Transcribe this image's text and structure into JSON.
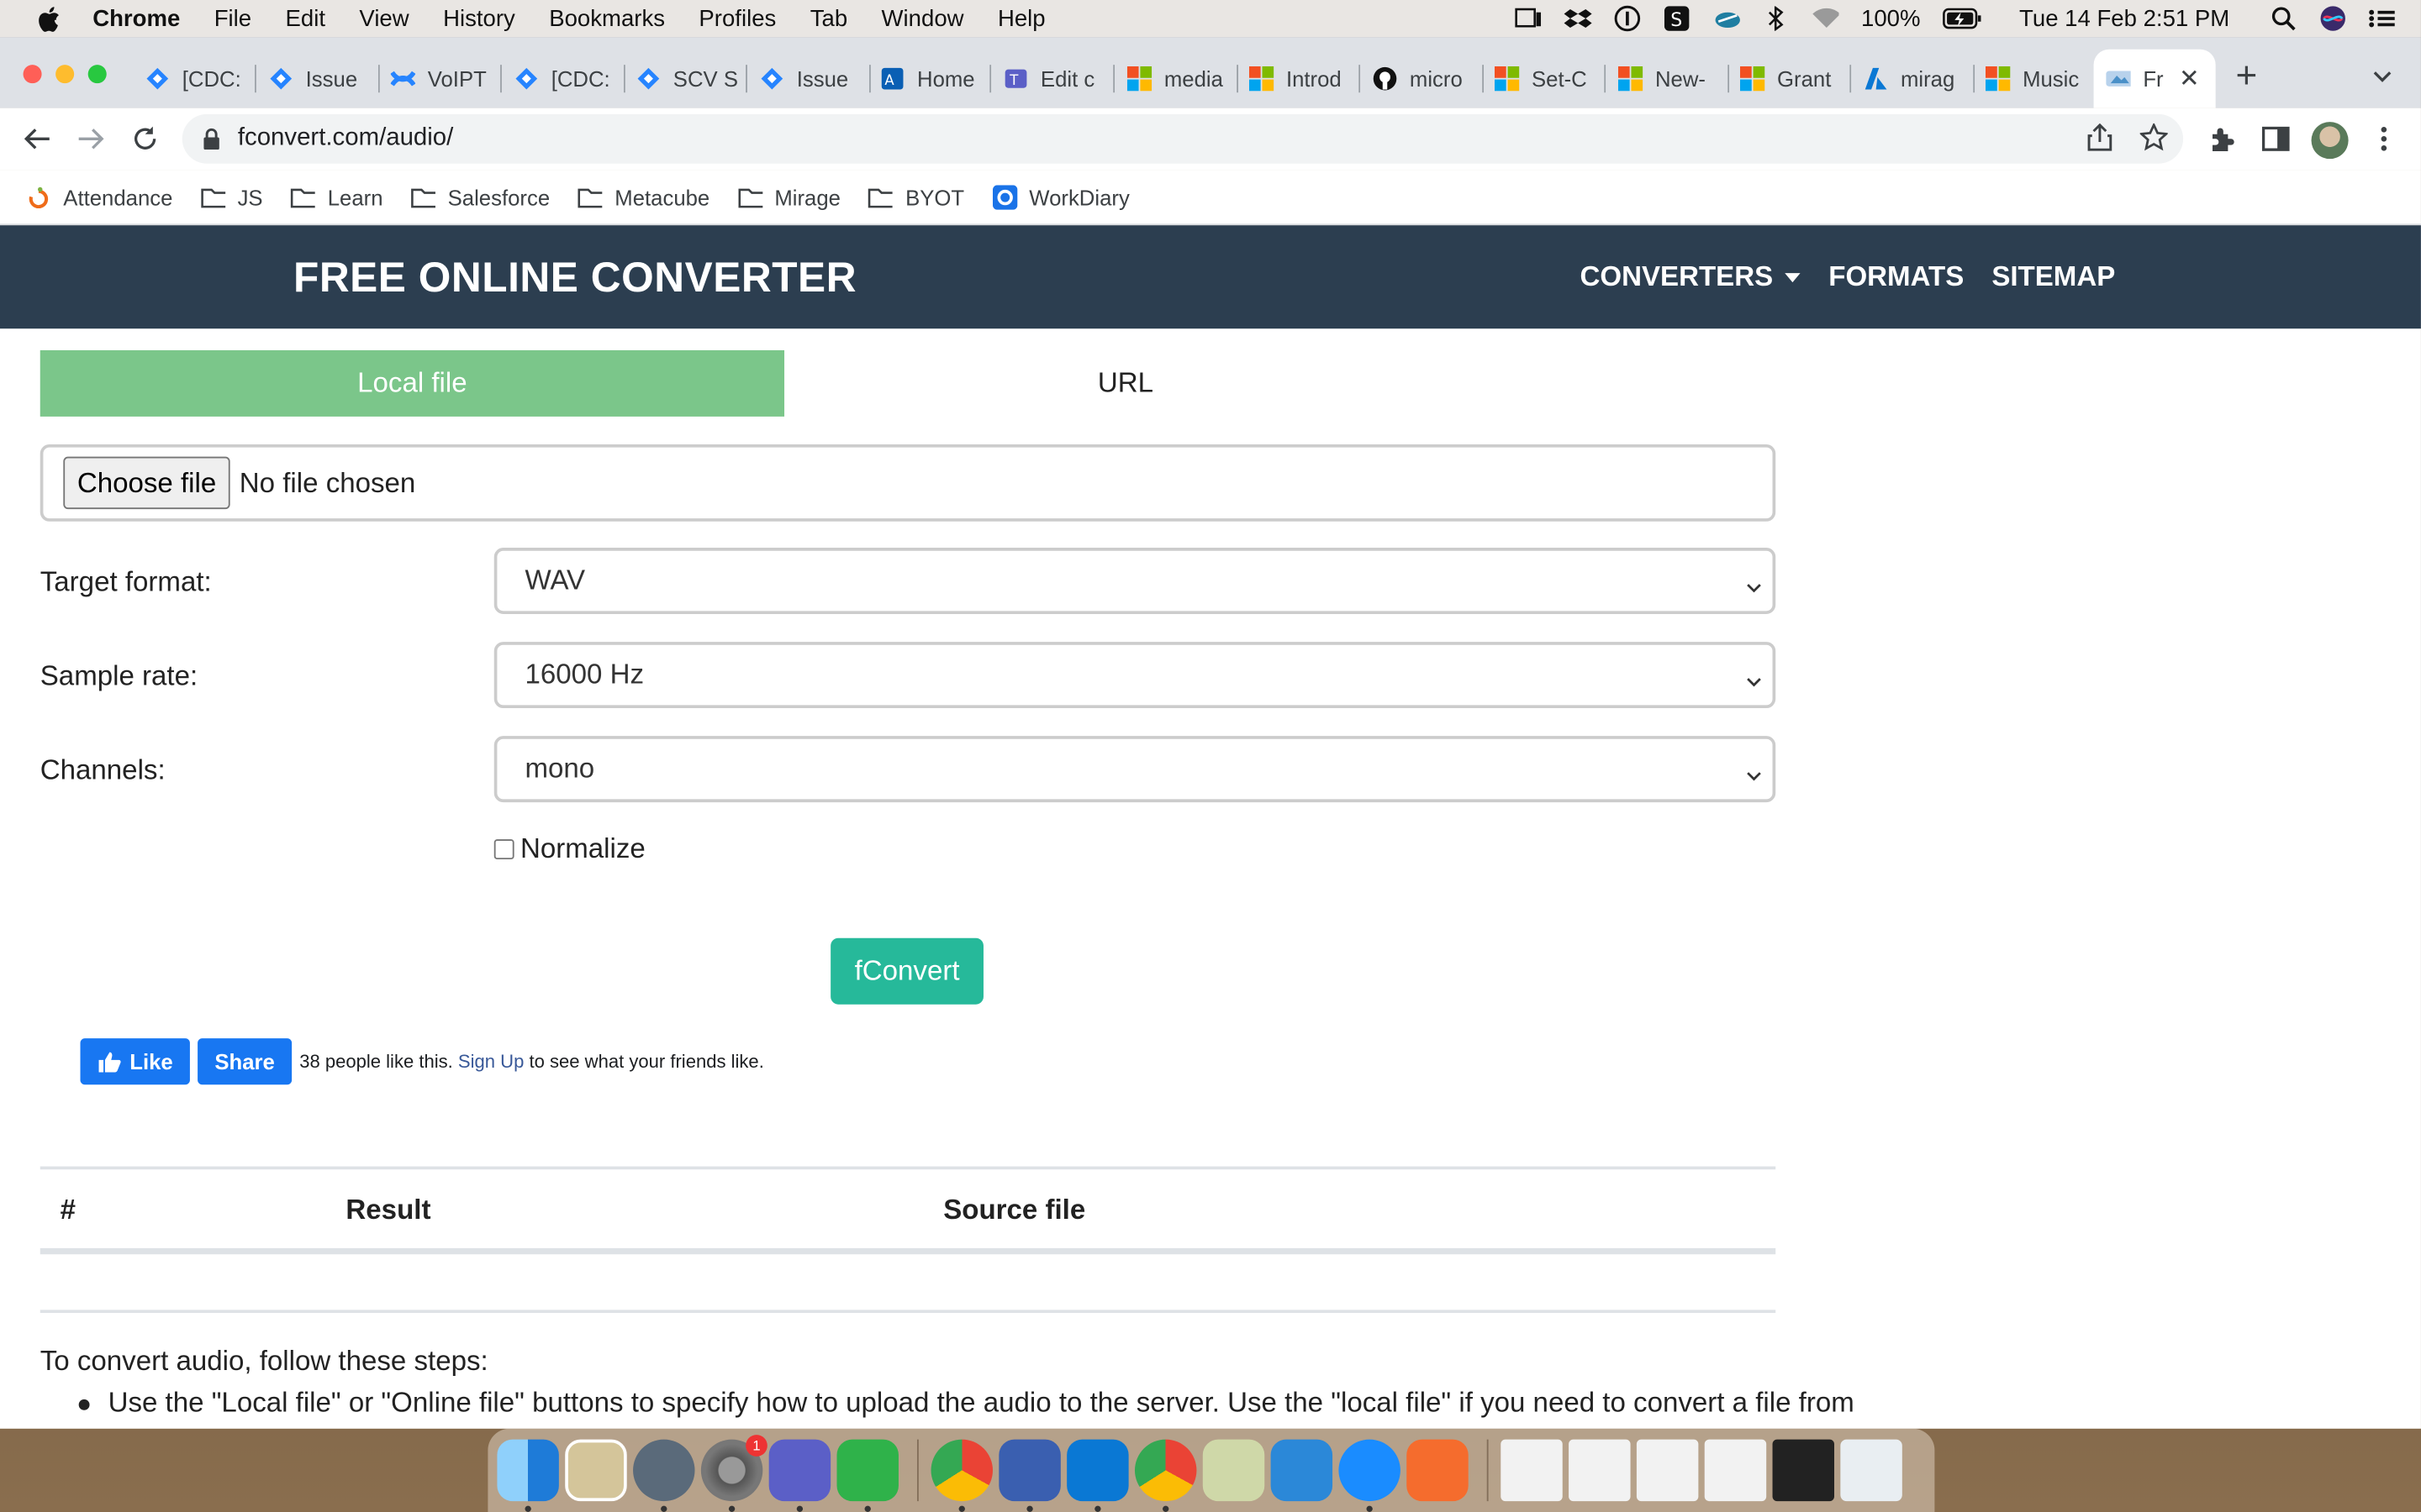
{
  "menubar": {
    "app": "Chrome",
    "items": [
      "File",
      "Edit",
      "View",
      "History",
      "Bookmarks",
      "Profiles",
      "Tab",
      "Window",
      "Help"
    ],
    "battery": "100%",
    "datetime": "Tue 14 Feb  2:51 PM"
  },
  "tabs": [
    {
      "label": "[CDC:",
      "icon": "jira-icon"
    },
    {
      "label": "Issue",
      "icon": "jira-icon"
    },
    {
      "label": "VoIPT",
      "icon": "confluence-icon"
    },
    {
      "label": "[CDC:",
      "icon": "jira-icon"
    },
    {
      "label": "SCV S",
      "icon": "jira-icon"
    },
    {
      "label": "Issue",
      "icon": "jira-icon"
    },
    {
      "label": "Home",
      "icon": "azure-icon"
    },
    {
      "label": "Edit c",
      "icon": "teams-icon"
    },
    {
      "label": "media",
      "icon": "microsoft-icon"
    },
    {
      "label": "Introd",
      "icon": "microsoft-icon"
    },
    {
      "label": "micro",
      "icon": "github-icon"
    },
    {
      "label": "Set-C",
      "icon": "microsoft-icon"
    },
    {
      "label": "New-",
      "icon": "microsoft-icon"
    },
    {
      "label": "Grant",
      "icon": "microsoft-icon"
    },
    {
      "label": "mirag",
      "icon": "azure-icon"
    },
    {
      "label": "Music",
      "icon": "microsoft-icon"
    }
  ],
  "active_tab": {
    "label": "Fr",
    "icon": "fconvert-icon"
  },
  "address_bar": {
    "url": "fconvert.com/audio/"
  },
  "bookmarks": [
    {
      "label": "Attendance",
      "icon": "attendance-icon"
    },
    {
      "label": "JS",
      "icon": "folder-icon"
    },
    {
      "label": "Learn",
      "icon": "folder-icon"
    },
    {
      "label": "Salesforce",
      "icon": "folder-icon"
    },
    {
      "label": "Metacube",
      "icon": "folder-icon"
    },
    {
      "label": "Mirage",
      "icon": "folder-icon"
    },
    {
      "label": "BYOT",
      "icon": "folder-icon"
    },
    {
      "label": "WorkDiary",
      "icon": "workdiary-icon"
    }
  ],
  "site": {
    "title": "FREE ONLINE CONVERTER",
    "nav": {
      "converters": "CONVERTERS",
      "formats": "FORMATS",
      "sitemap": "SITEMAP"
    },
    "header_color": "#2c3e50"
  },
  "upload": {
    "tab_local": "Local file",
    "tab_url": "URL",
    "choose_button": "Choose file",
    "file_status": "No file chosen",
    "active_color": "#7bc68a"
  },
  "form": {
    "target_format_label": "Target format:",
    "target_format_value": "WAV",
    "sample_rate_label": "Sample rate:",
    "sample_rate_value": "16000 Hz",
    "channels_label": "Channels:",
    "channels_value": "mono",
    "normalize_label": "Normalize",
    "normalize_checked": false,
    "submit_label": "fConvert",
    "submit_color": "#26b99a"
  },
  "facebook": {
    "like": "Like",
    "share": "Share",
    "text_before": "38 people like this.",
    "signup": "Sign Up",
    "text_after": "to see what your friends like."
  },
  "results_table": {
    "headers": [
      "#",
      "Result",
      "Source file"
    ]
  },
  "instructions": {
    "title": "To convert audio, follow these steps:",
    "steps": [
      "Use the \"Local file\" or \"Online file\" buttons to specify how to upload the audio to the server. Use the \"local file\" if you need to convert a file from"
    ]
  },
  "dock": {
    "apps": [
      "finder-icon",
      "preview-icon",
      "launchpad-icon",
      "system-preferences-icon",
      "teams-icon",
      "messages-icon",
      "chrome-icon",
      "parallels-icon",
      "windows-icon",
      "chrome-icon",
      "script-editor-icon",
      "azure-data-studio-icon",
      "onepassword-icon",
      "paw-icon"
    ],
    "settings_badge": "1"
  }
}
